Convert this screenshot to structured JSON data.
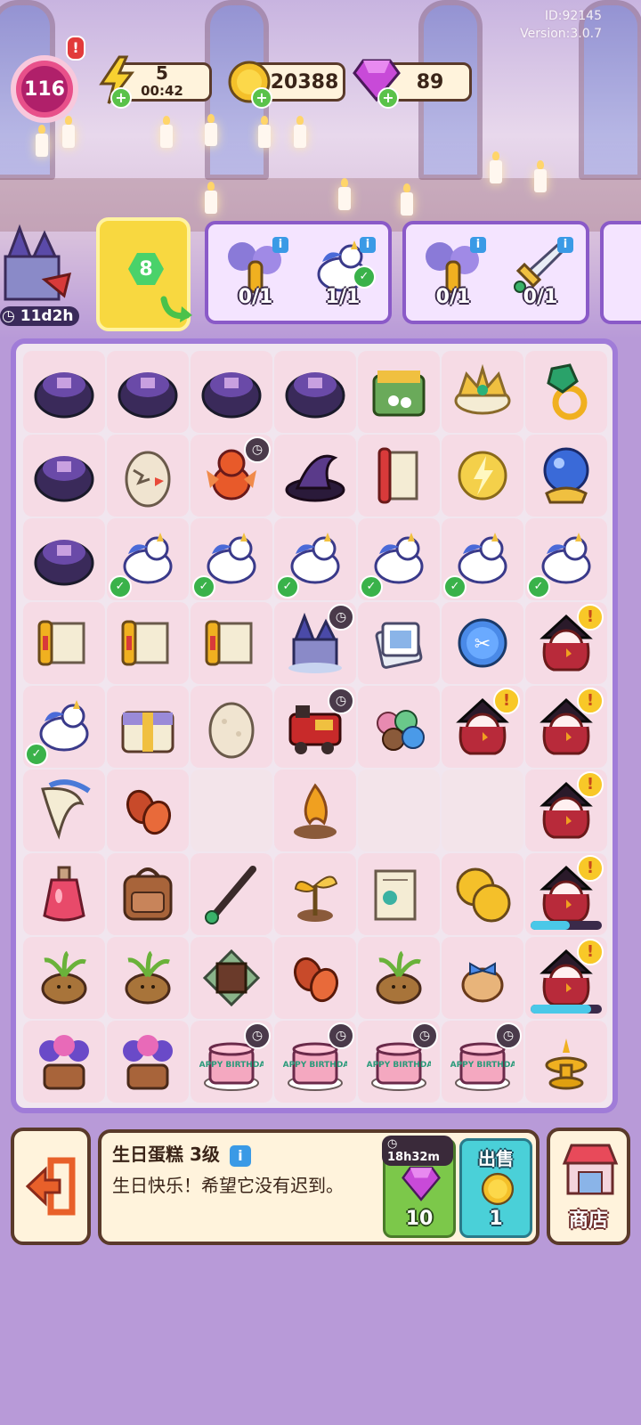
{
  "debug": {
    "id": "ID:92145",
    "version": "Version:3.0.7"
  },
  "hud": {
    "level": "116",
    "level_alert": "!",
    "energy": "5",
    "energy_timer": "00:42",
    "coins": "20388",
    "gems": "89",
    "plus": "+"
  },
  "quests": {
    "event_timer": "11d2h",
    "card_level": "8",
    "quest1": [
      {
        "icon": "potion-flowers-icon",
        "count": "0/1"
      },
      {
        "icon": "unicorn-icon",
        "count": "1/1",
        "done": true
      }
    ],
    "quest2": [
      {
        "icon": "potion-flowers-icon",
        "count": "0/1"
      },
      {
        "icon": "dagger-icon",
        "count": "0/1"
      }
    ]
  },
  "board": {
    "rows": [
      [
        "robe",
        "robe",
        "robe",
        "robe",
        "treasure-chest",
        "tiara",
        "emerald-ring"
      ],
      [
        "robe",
        "cracked-egg",
        "red-dragon",
        "witch-hat",
        "scroll",
        "energy-coin",
        "crystal-ball"
      ],
      [
        "robe",
        "unicorn",
        "unicorn",
        "unicorn",
        "unicorn",
        "unicorn",
        "unicorn"
      ],
      [
        "scroll-gold",
        "scroll-gold",
        "scroll-gold",
        "castle",
        "card-deck",
        "magic-button",
        "witch"
      ],
      [
        "unicorn",
        "chest-box",
        "egg",
        "train",
        "gumdrops",
        "witch",
        "witch"
      ],
      [
        "horn",
        "cocoa-beans",
        "empty",
        "flame",
        "empty",
        "empty",
        "witch"
      ],
      [
        "potion-bottle",
        "backpack",
        "wand",
        "sapling",
        "letter",
        "coins",
        "witch"
      ],
      [
        "mandrake",
        "mandrake",
        "chocolate",
        "cocoa-beans",
        "mandrake",
        "bread-ribbon",
        "witch"
      ],
      [
        "flower-pot",
        "flower-pot",
        "cake",
        "cake",
        "cake",
        "cake",
        "golden-fountain"
      ]
    ],
    "checks": [
      [
        2,
        1
      ],
      [
        2,
        2
      ],
      [
        2,
        3
      ],
      [
        2,
        4
      ],
      [
        2,
        5
      ],
      [
        2,
        6
      ],
      [
        4,
        0
      ]
    ],
    "clocks": [
      [
        1,
        2
      ],
      [
        3,
        3
      ],
      [
        4,
        3
      ],
      [
        8,
        2
      ],
      [
        8,
        3
      ],
      [
        8,
        4
      ],
      [
        8,
        5
      ]
    ],
    "alerts": [
      [
        3,
        6
      ],
      [
        4,
        5
      ],
      [
        4,
        6
      ],
      [
        5,
        6
      ],
      [
        6,
        6
      ],
      [
        7,
        6
      ]
    ],
    "progress": [
      [
        6,
        6,
        0.55
      ],
      [
        7,
        6,
        0.85
      ]
    ],
    "cake_text": "HAPPY BIRTHDAY"
  },
  "panel": {
    "title": "生日蛋糕 3级",
    "description": "生日快乐！希望它没有迟到。",
    "speed_timer": "18h32m",
    "speed_cost": "10",
    "sell_label": "出售",
    "sell_value": "1",
    "shop_label": "商店"
  },
  "colors": {
    "board_border": "#a07cd8",
    "panel_border": "#5a3a2a",
    "accent_pink": "#e8508a"
  }
}
